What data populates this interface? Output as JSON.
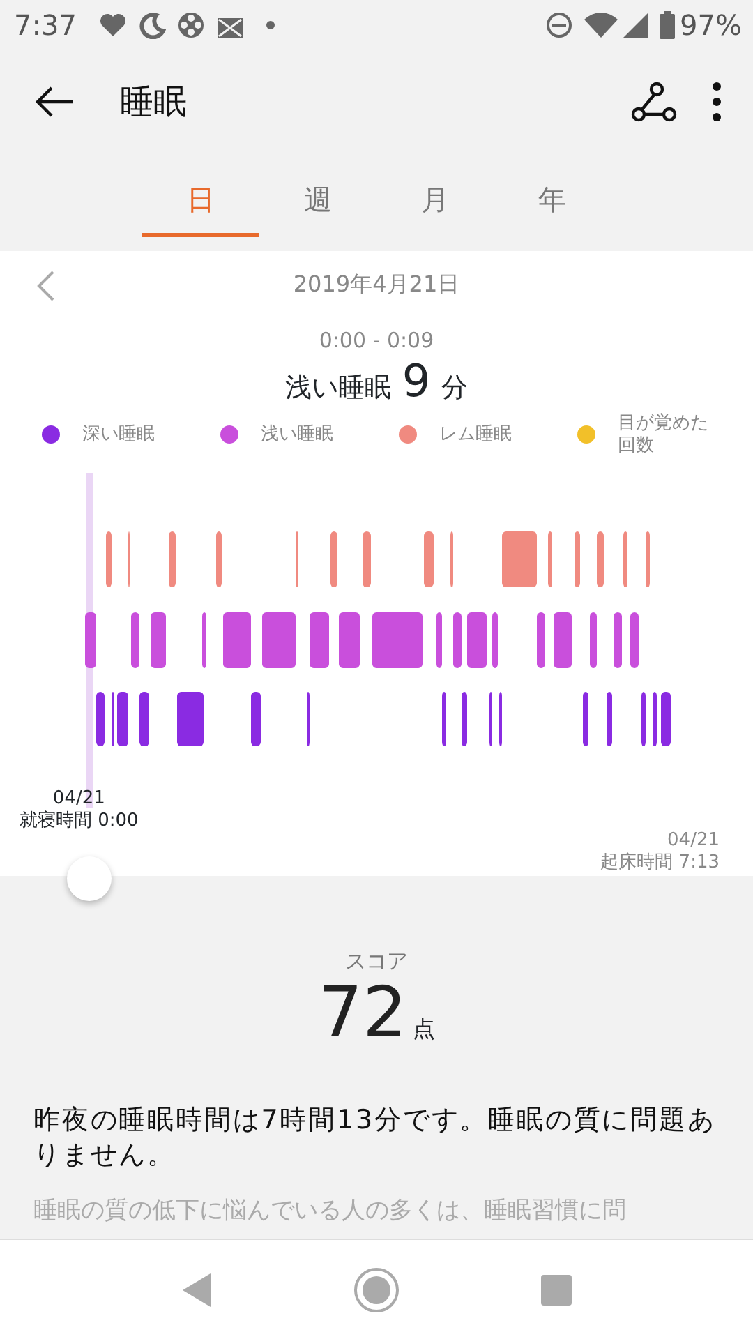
{
  "status_bar": {
    "time": "7:37",
    "battery": "97%"
  },
  "app_bar": {
    "title": "睡眠"
  },
  "tabs": [
    {
      "label": "日",
      "selected": true
    },
    {
      "label": "週",
      "selected": false
    },
    {
      "label": "月",
      "selected": false
    },
    {
      "label": "年",
      "selected": false
    }
  ],
  "date": "2019年4月21日",
  "selection": {
    "range": "0:00 - 0:09",
    "stage": "浅い睡眠",
    "value": "9",
    "unit": "分"
  },
  "legend": [
    {
      "label": "深い睡眠",
      "color": "#8a2be2"
    },
    {
      "label": "浅い睡眠",
      "color": "#c94fdc"
    },
    {
      "label": "レム睡眠",
      "color": "#f08a80"
    },
    {
      "label": "目が覚めた回数",
      "color": "#f2c029"
    }
  ],
  "chart": {
    "start_date": "04/21",
    "start_label": "就寝時間 0:00",
    "end_date": "04/21",
    "end_label": "起床時間 7:13"
  },
  "score": {
    "label": "スコア",
    "value": "72",
    "unit": "点"
  },
  "summary": "昨夜の睡眠時間は7時間13分です。睡眠の質に問題ありません。",
  "advice": "睡眠の質の低下に悩んでいる人の多くは、睡眠習慣に問"
}
